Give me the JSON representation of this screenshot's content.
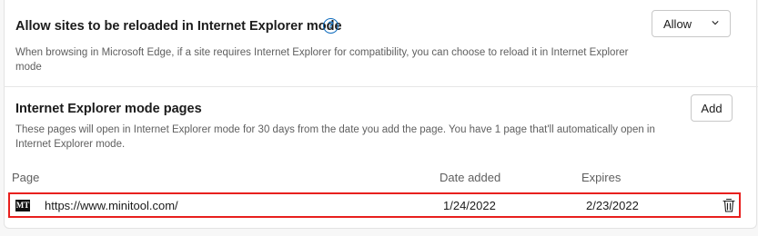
{
  "reload_setting": {
    "title": "Allow sites to be reloaded in Internet Explorer mode",
    "help_glyph": "?",
    "description": "When browsing in Microsoft Edge, if a site requires Internet Explorer for compatibility, you can choose to reload it in Internet Explorer mode",
    "dropdown_value": "Allow"
  },
  "ie_pages": {
    "title": "Internet Explorer mode pages",
    "description": "These pages will open in Internet Explorer mode for 30 days from the date you add the page. You have 1 page that'll automatically open in Internet Explorer mode.",
    "add_label": "Add",
    "columns": {
      "page": "Page",
      "date_added": "Date added",
      "expires": "Expires"
    },
    "rows": [
      {
        "favicon_text": "MT",
        "url": "https://www.minitool.com/",
        "date_added": "1/24/2022",
        "expires": "2/23/2022"
      }
    ]
  },
  "colors": {
    "accent": "#0f6cbd",
    "highlight_border": "#e8201e"
  }
}
